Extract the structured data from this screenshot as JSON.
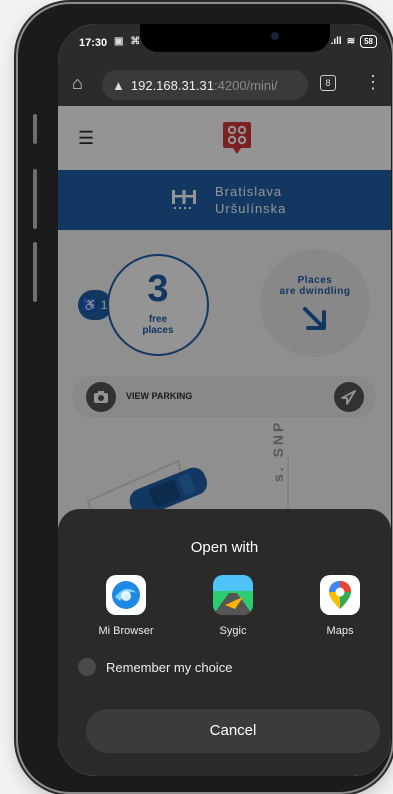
{
  "status_bar": {
    "time": "17:30",
    "left_icons": "▣ ⌘",
    "signal": ".ıll",
    "wifi": "≋",
    "battery": "58"
  },
  "browser": {
    "url_host": "192.168.31.31",
    "url_path": ":4200/mini/",
    "tab_count": "8"
  },
  "page": {
    "location": {
      "city": "Bratislava",
      "street": "Uršulínska"
    },
    "accessible_spots": "1",
    "free_places": {
      "count": "3",
      "label_line1": "free",
      "label_line2": "places"
    },
    "trend": {
      "line1": "Places",
      "line2": "are dwindling"
    },
    "view_parking_label": "VIEW PARKING",
    "map_street_label": "s. SNP"
  },
  "dialog": {
    "title": "Open with",
    "apps": [
      {
        "name": "Mi Browser",
        "icon": "mi-browser-icon"
      },
      {
        "name": "Sygic",
        "icon": "sygic-icon"
      },
      {
        "name": "Maps",
        "icon": "google-maps-icon"
      }
    ],
    "remember_label": "Remember my choice",
    "cancel_label": "Cancel"
  },
  "colors": {
    "brand_blue": "#1f5fa8",
    "logo_red": "#d63a3a",
    "sheet_bg": "#2a2a2a"
  }
}
